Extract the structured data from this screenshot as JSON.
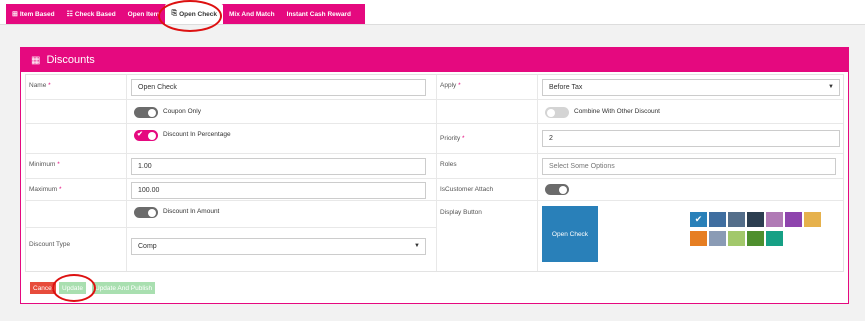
{
  "tabs": [
    {
      "label": "Item Based",
      "icon": "item-icon"
    },
    {
      "label": "Check Based",
      "icon": "check-icon"
    },
    {
      "label": "Open Item",
      "icon": ""
    },
    {
      "label": "Open Check",
      "icon": "open-check-icon"
    },
    {
      "label": "Mix And Match",
      "icon": ""
    },
    {
      "label": "Instant Cash Reward",
      "icon": ""
    }
  ],
  "panel": {
    "title": "Discounts"
  },
  "form": {
    "name": {
      "label": "Name",
      "required": "*",
      "value": "Open Check"
    },
    "coupon_only": {
      "label": "Coupon Only",
      "state": "off"
    },
    "discount_in_percentage": {
      "label": "Discount In Percentage",
      "state": "on"
    },
    "minimum": {
      "label": "Minimum",
      "required": "*",
      "value": "1.00"
    },
    "maximum": {
      "label": "Maximum",
      "required": "*",
      "value": "100.00"
    },
    "discount_in_amount": {
      "label": "Discount In Amount",
      "state": "off"
    },
    "discount_type": {
      "label": "Discount Type",
      "value": "Comp"
    },
    "apply": {
      "label": "Apply",
      "required": "*",
      "value": "Before Tax"
    },
    "combine": {
      "label": "Combine With Other Discount",
      "state": "disabled"
    },
    "priority": {
      "label": "Priority",
      "required": "*",
      "value": "2"
    },
    "roles": {
      "label": "Roles",
      "placeholder": "Select Some Options"
    },
    "is_customer_attach": {
      "label": "IsCustomer Attach",
      "state": "off"
    },
    "display_button": {
      "label": "Display Button",
      "preview_text": "Open Check"
    }
  },
  "swatches": {
    "row1": [
      "#2980b9",
      "#3f6ea0",
      "#546e8a",
      "#2c3e50",
      "#b07ab5",
      "#8e44ad",
      "#e6b14c"
    ],
    "row2": [
      "#e67e22",
      "#8a9bb5",
      "#a2c86b",
      "#4e8f2e",
      "#16a085"
    ],
    "selected": 0
  },
  "actions": {
    "cancel": "Cancel",
    "update": "Update",
    "update_publish": "Update And Publish"
  },
  "colors": {
    "accent": "#e5097f",
    "cancel": "#e74c3c",
    "update": "#a9dfb0"
  }
}
